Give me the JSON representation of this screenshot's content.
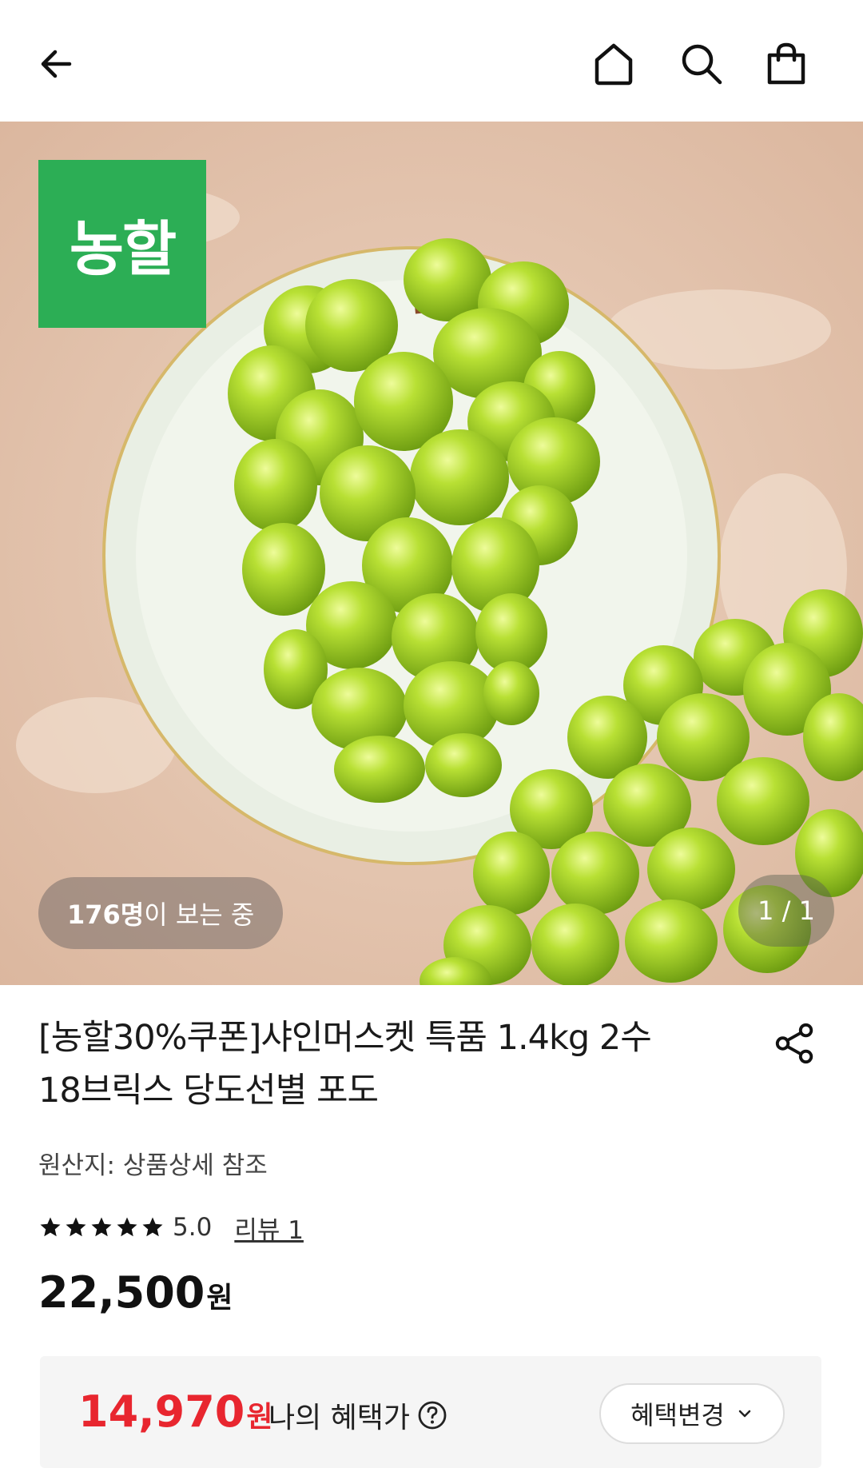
{
  "header": {
    "back_icon": "arrow-left-icon",
    "home_icon": "home-icon",
    "search_icon": "search-icon",
    "cart_icon": "shopping-bag-icon"
  },
  "hero": {
    "brand_logo_text": "농할",
    "brand_color": "#2cae55",
    "viewers_count": "176명",
    "viewers_suffix": "이 보는 중",
    "image_counter": "1 / 1"
  },
  "product": {
    "title_line1": "[농할30%쿠폰]샤인머스켓 특품 1.4kg 2수",
    "title_line2": "18브릭스 당도선별 포도",
    "origin": "원산지: 상품상세 참조",
    "rating": "5.0",
    "rating_stars": 5,
    "review_link": "리뷰 1",
    "price": "22,500",
    "price_unit": "원"
  },
  "benefit": {
    "price": "14,970",
    "price_unit": "원",
    "label": "나의 혜택가",
    "change_button": "혜택변경",
    "accent_color": "#e8262f"
  }
}
